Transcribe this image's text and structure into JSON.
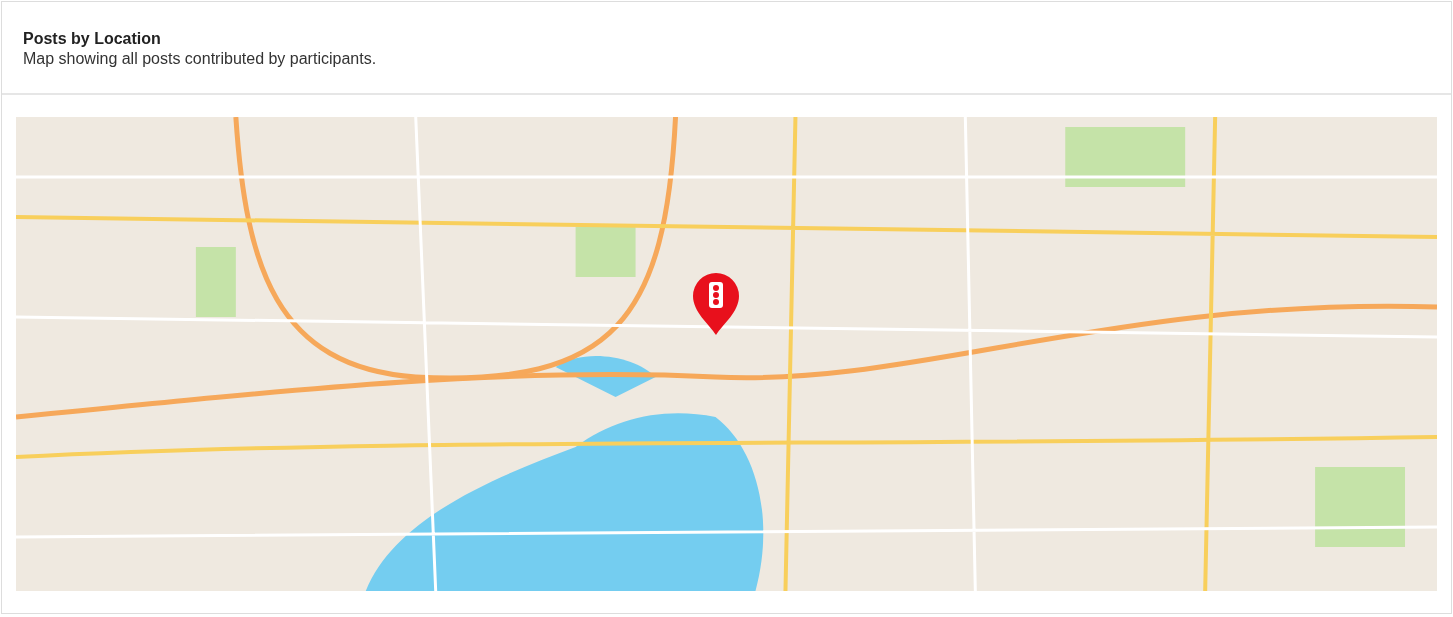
{
  "card": {
    "title": "Posts by Location",
    "description": "Map showing all posts contributed by participants."
  },
  "map": {
    "kind": "picture",
    "markers": [
      {
        "kind": "traffic-light"
      }
    ]
  }
}
